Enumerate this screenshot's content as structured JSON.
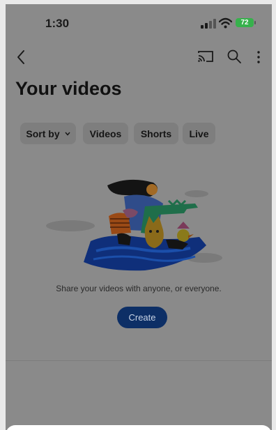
{
  "status_bar": {
    "time": "1:30",
    "battery": "72"
  },
  "header": {
    "title": "Your videos"
  },
  "chips": {
    "sort_label": "Sort by",
    "videos_label": "Videos",
    "shorts_label": "Shorts",
    "live_label": "Live"
  },
  "empty_state": {
    "message": "Share your videos with anyone, or everyone.",
    "create_label": "Create"
  },
  "colors": {
    "create_button": "#0d2f66",
    "battery": "#37b14c",
    "overlay_background": "#8a8a8a"
  },
  "icons": [
    "signal-icon",
    "wifi-icon",
    "back-arrow-icon",
    "cast-icon",
    "search-icon",
    "more-vertical-icon",
    "chevron-down-icon"
  ]
}
